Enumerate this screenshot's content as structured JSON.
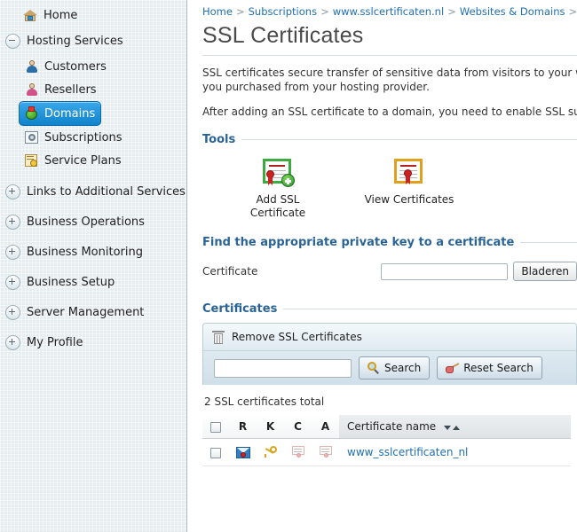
{
  "sidebar": {
    "home": {
      "label": "Home",
      "icon": "home-icon"
    },
    "groups": [
      {
        "label": "Hosting Services",
        "expanded": true,
        "toggle": "minus",
        "children": [
          {
            "label": "Customers",
            "icon": "customers-icon",
            "active": false
          },
          {
            "label": "Resellers",
            "icon": "resellers-icon",
            "active": false
          },
          {
            "label": "Domains",
            "icon": "domains-icon",
            "active": true
          },
          {
            "label": "Subscriptions",
            "icon": "subscriptions-icon",
            "active": false
          },
          {
            "label": "Service Plans",
            "icon": "service-plans-icon",
            "active": false
          }
        ]
      },
      {
        "label": "Links to Additional Services",
        "expanded": false,
        "toggle": "plus",
        "children": []
      },
      {
        "label": "Business Operations",
        "expanded": false,
        "toggle": "plus",
        "children": []
      },
      {
        "label": "Business Monitoring",
        "expanded": false,
        "toggle": "plus",
        "children": []
      },
      {
        "label": "Business Setup",
        "expanded": false,
        "toggle": "plus",
        "children": []
      },
      {
        "label": "Server Management",
        "expanded": false,
        "toggle": "plus",
        "children": []
      },
      {
        "label": "My Profile",
        "expanded": false,
        "toggle": "plus",
        "children": []
      }
    ]
  },
  "breadcrumb": {
    "items": [
      "Home",
      "Subscriptions",
      "www.sslcertificaten.nl",
      "Websites & Domains"
    ],
    "separator": ">",
    "trailing_separator": ">"
  },
  "page": {
    "title": "SSL Certificates",
    "description_line1": "SSL certificates secure transfer of sensitive data from visitors to your w",
    "description_line2": "you purchased from your hosting provider.",
    "description_line3": "After adding an SSL certificate to a domain, you need to enable SSL sup"
  },
  "tools": {
    "heading": "Tools",
    "items": [
      {
        "label_line1": "Add SSL",
        "label_line2": "Certificate",
        "icon": "add-ssl-certificate-icon"
      },
      {
        "label_line1": "View Certificates",
        "label_line2": "",
        "icon": "view-certificates-icon"
      }
    ]
  },
  "private_key": {
    "heading": "Find the appropriate private key to a certificate",
    "field_label": "Certificate",
    "field_value": "",
    "field_placeholder": "",
    "browse_button": "Bladeren"
  },
  "certificates": {
    "heading": "Certificates",
    "toolbar": {
      "remove_label": "Remove SSL Certificates",
      "remove_icon": "trash-icon"
    },
    "search": {
      "value": "",
      "placeholder": "",
      "search_button": "Search",
      "search_button_accesskey": "S",
      "search_icon": "magnifier-icon",
      "reset_button": "Reset Search",
      "reset_button_accesskey": "R",
      "reset_icon": "broom-icon"
    },
    "total_text": "2 SSL certificates total",
    "columns": [
      "",
      "R",
      "K",
      "C",
      "A",
      "Certificate name"
    ],
    "sorted_column": "Certificate name",
    "rows": [
      {
        "selected": false,
        "r_icon": "certificate-request-icon",
        "k_icon": "private-key-icon",
        "c_icon": "certificate-icon",
        "a_icon": "ca-certificate-icon",
        "name": "www_sslcertificaten_nl"
      }
    ]
  },
  "colors": {
    "accent_blue": "#1f6fb2",
    "section_heading": "#2a6496",
    "sidebar_bg": "#e6edf0",
    "active_item": "#1083cd",
    "panel_bg": "#e8f0f5"
  }
}
